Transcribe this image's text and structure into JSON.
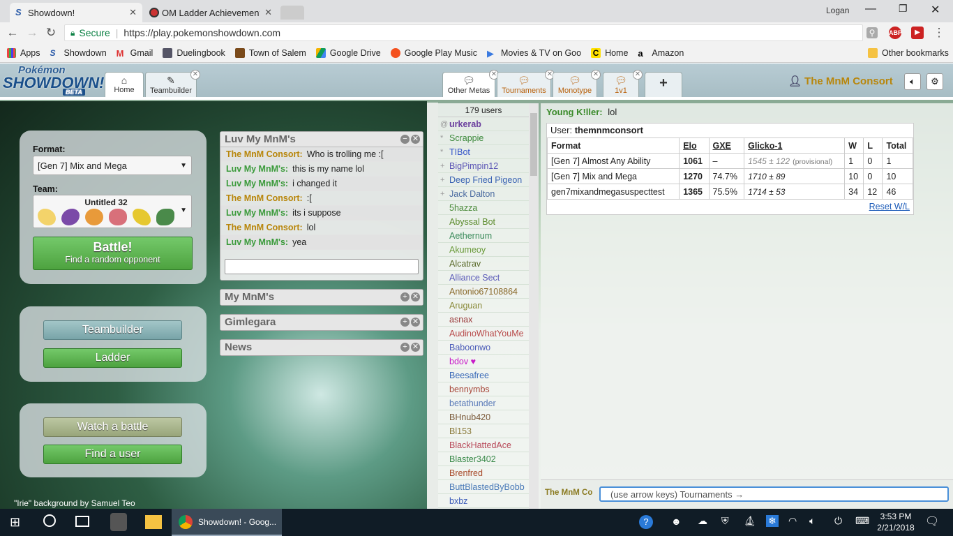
{
  "browser": {
    "tabs": [
      {
        "title": "Showdown!",
        "active": true
      },
      {
        "title": "OM Ladder Achievement",
        "active": false
      }
    ],
    "profile": "Logan",
    "secure_label": "Secure",
    "url": "https://play.pokemonshowdown.com",
    "bookmarks": [
      "Apps",
      "Showdown",
      "Gmail",
      "Duelingbook",
      "Town of Salem",
      "Google Drive",
      "Google Play Music",
      "Movies & TV on Goo",
      "Home",
      "Amazon"
    ],
    "other_bookmarks": "Other bookmarks"
  },
  "header": {
    "logo_top": "Pokémon",
    "logo_main": "SHOWDOWN!",
    "logo_badge": "BETA",
    "tabs": [
      {
        "label": "Home"
      },
      {
        "label": "Teambuilder"
      }
    ],
    "room_tabs": [
      {
        "label": "Other Metas"
      },
      {
        "label": "Tournaments"
      },
      {
        "label": "Monotype"
      },
      {
        "label": "1v1"
      }
    ],
    "add_tab": "+",
    "username": "The MnM Consort"
  },
  "home": {
    "format_label": "Format:",
    "format_value": "[Gen 7] Mix and Mega",
    "team_label": "Team:",
    "team_name": "Untitled 32",
    "battle_label": "Battle!",
    "battle_sub": "Find a random opponent",
    "teambuilder_btn": "Teambuilder",
    "ladder_btn": "Ladder",
    "watch_btn": "Watch a battle",
    "find_btn": "Find a user",
    "credit": "\"Irie\" background by Samuel Teo"
  },
  "pm": {
    "title": "Luv My MnM's",
    "messages": [
      {
        "user": "The MnM Consort:",
        "text": "Who is trolling me :["
      },
      {
        "user": "Luv My MnM's:",
        "text": "this is my name lol"
      },
      {
        "user": "Luv My MnM's:",
        "text": "i changed it"
      },
      {
        "user": "The MnM Consort:",
        "text": ":["
      },
      {
        "user": "Luv My MnM's:",
        "text": "its i suppose"
      },
      {
        "user": "The MnM Consort:",
        "text": "lol"
      },
      {
        "user": "Luv My MnM's:",
        "text": "yea"
      }
    ],
    "collapsed": [
      "My MnM's",
      "Gimlegara",
      "News"
    ]
  },
  "userlist": {
    "count": "179 users",
    "users": [
      {
        "name": "urkerab",
        "group": "@",
        "color": "#6b3f9e"
      },
      {
        "name": "Scrappie",
        "group": "*",
        "color": "#3d8a3d"
      },
      {
        "name": "TIBot",
        "group": "*",
        "color": "#3555c9"
      },
      {
        "name": "BigPimpin12",
        "group": "+",
        "color": "#5b55b5"
      },
      {
        "name": "Deep Fried Pigeon",
        "group": "+",
        "color": "#3a63b3"
      },
      {
        "name": "Jack Dalton",
        "group": "+",
        "color": "#4a6aa0"
      },
      {
        "name": "5hazza",
        "group": "",
        "color": "#4a8a3a"
      },
      {
        "name": "Abyssal Bot",
        "group": "",
        "color": "#5a8a2a"
      },
      {
        "name": "Aethernum",
        "group": "",
        "color": "#3a8a5a"
      },
      {
        "name": "Akumeoy",
        "group": "",
        "color": "#6a9a3a"
      },
      {
        "name": "Alcatrav",
        "group": "",
        "color": "#5a6a2a"
      },
      {
        "name": "Alliance Sect",
        "group": "",
        "color": "#5a5ab8"
      },
      {
        "name": "Antonio67108864",
        "group": "",
        "color": "#8a6a2a"
      },
      {
        "name": "Aruguan",
        "group": "",
        "color": "#8a8a3a"
      },
      {
        "name": "asnax",
        "group": "",
        "color": "#9a3a3a"
      },
      {
        "name": "AudinoWhatYouMe",
        "group": "",
        "color": "#b84a4a"
      },
      {
        "name": "Baboonwo",
        "group": "",
        "color": "#4a5ab8"
      },
      {
        "name": "bdov ♥",
        "group": "",
        "color": "#c81ac8"
      },
      {
        "name": "Beesafree",
        "group": "",
        "color": "#3a6ab8"
      },
      {
        "name": "bennymbs",
        "group": "",
        "color": "#a8483a"
      },
      {
        "name": "betathunder",
        "group": "",
        "color": "#5a7ab8"
      },
      {
        "name": "BHnub420",
        "group": "",
        "color": "#7a5a3a"
      },
      {
        "name": "Bl153",
        "group": "",
        "color": "#8a7a3a"
      },
      {
        "name": "BlackHattedAce",
        "group": "",
        "color": "#b84a5a"
      },
      {
        "name": "Blaster3402",
        "group": "",
        "color": "#3a8a4a"
      },
      {
        "name": "Brenfred",
        "group": "",
        "color": "#a84a2a"
      },
      {
        "name": "ButtBlastedByBobb",
        "group": "",
        "color": "#4a7ab8"
      },
      {
        "name": "bxbz",
        "group": "",
        "color": "#3a5ab8"
      }
    ]
  },
  "room": {
    "last_msg_user": "Young K!ller:",
    "last_msg_text": "lol",
    "user_label": "User:",
    "user_name": "themnmconsort",
    "columns": [
      "Format",
      "Elo",
      "GXE",
      "Glicko-1",
      "W",
      "L",
      "Total"
    ],
    "rows": [
      {
        "format": "[Gen 7] Almost Any Ability",
        "elo": "1061",
        "gxe": "–",
        "glicko": "1545 ± 122",
        "note": "(provisional)",
        "w": "1",
        "l": "0",
        "total": "1"
      },
      {
        "format": "[Gen 7] Mix and Mega",
        "elo": "1270",
        "gxe": "74.7%",
        "glicko": "1710 ± 89",
        "note": "",
        "w": "10",
        "l": "0",
        "total": "10"
      },
      {
        "format": "gen7mixandmegasuspecttest",
        "elo": "1365",
        "gxe": "75.5%",
        "glicko": "1714 ± 53",
        "note": "",
        "w": "34",
        "l": "12",
        "total": "46"
      }
    ],
    "reset": "Reset W/L",
    "input_user": "The MnM Co",
    "input_placeholder": "(use arrow keys) Tournaments →"
  },
  "taskbar": {
    "app": "Showdown! - Goog...",
    "time": "3:53 PM",
    "date": "2/21/2018"
  }
}
